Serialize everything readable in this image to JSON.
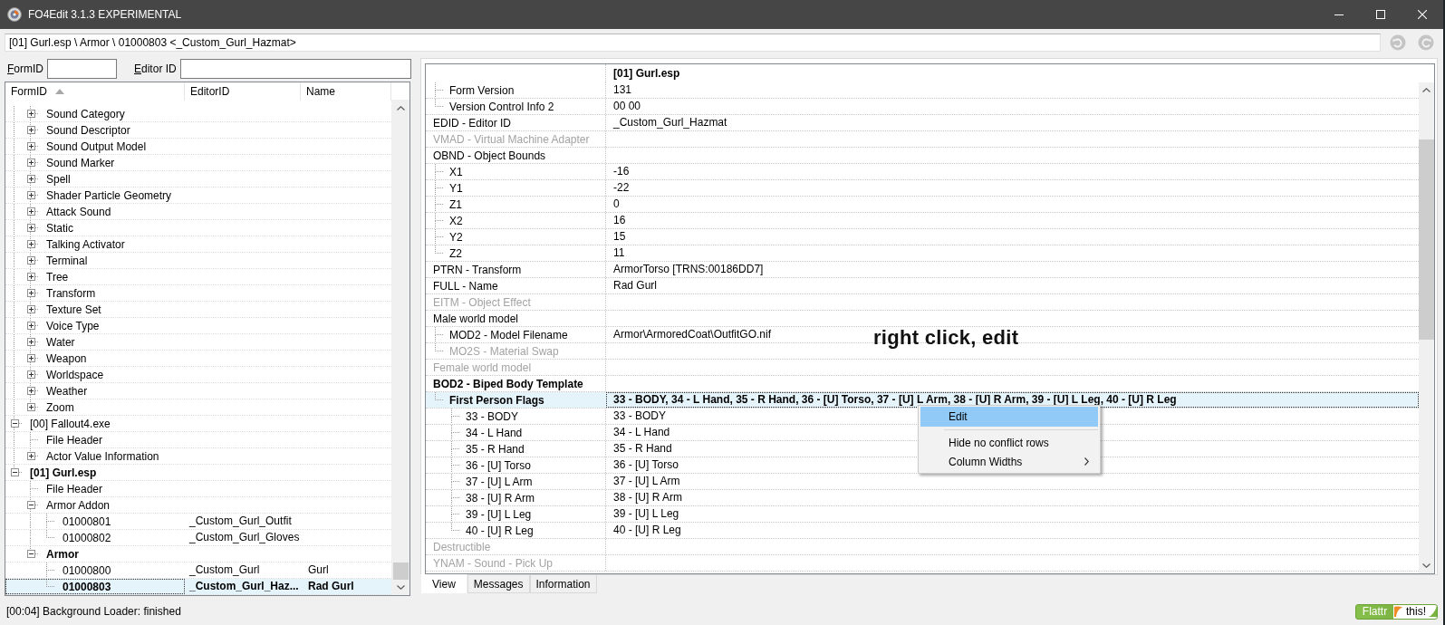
{
  "window": {
    "title": "FO4Edit 3.1.3 EXPERIMENTAL"
  },
  "path_bar": {
    "value": "[01] Gurl.esp \\ Armor \\ 01000803 <_Custom_Gurl_Hazmat>"
  },
  "filters": [
    {
      "label": "FormID"
    },
    {
      "label": "Editor ID"
    }
  ],
  "tree": {
    "columns": [
      {
        "label": "FormID",
        "sorted": true
      },
      {
        "label": "EditorID",
        "sorted": false
      },
      {
        "label": "Name",
        "sorted": false
      }
    ],
    "items": [
      {
        "children": [
          {
            "label": "Sound Category",
            "expanded": false,
            "bold": false,
            "selected": false
          },
          {
            "label": "Sound Descriptor",
            "expanded": false,
            "bold": false,
            "selected": false
          },
          {
            "label": "Sound Output Model",
            "expanded": false,
            "bold": false,
            "selected": false
          },
          {
            "label": "Sound Marker",
            "expanded": false,
            "bold": false,
            "selected": false
          },
          {
            "label": "Spell",
            "expanded": false,
            "bold": false,
            "selected": false
          },
          {
            "label": "Shader Particle Geometry",
            "expanded": false,
            "bold": false,
            "selected": false
          },
          {
            "label": "Attack Sound",
            "expanded": false,
            "bold": false,
            "selected": false
          },
          {
            "label": "Static",
            "expanded": false,
            "bold": false,
            "selected": false
          },
          {
            "label": "Talking Activator",
            "expanded": false,
            "bold": false,
            "selected": false
          },
          {
            "label": "Terminal",
            "expanded": false,
            "bold": false,
            "selected": false
          },
          {
            "label": "Tree",
            "expanded": false,
            "bold": false,
            "selected": false
          },
          {
            "label": "Transform",
            "expanded": false,
            "bold": false,
            "selected": false
          },
          {
            "label": "Texture Set",
            "expanded": false,
            "bold": false,
            "selected": false
          },
          {
            "label": "Voice Type",
            "expanded": false,
            "bold": false,
            "selected": false
          },
          {
            "label": "Water",
            "expanded": false,
            "bold": false,
            "selected": false
          },
          {
            "label": "Weapon",
            "expanded": false,
            "bold": false,
            "selected": false
          },
          {
            "label": "Worldspace",
            "expanded": false,
            "bold": false,
            "selected": false
          },
          {
            "label": "Weather",
            "expanded": false,
            "bold": false,
            "selected": false
          },
          {
            "label": "Zoom",
            "expanded": false,
            "bold": false,
            "selected": false
          }
        ]
      },
      {
        "label": "[00] Fallout4.exe",
        "expanded": true,
        "bold": false,
        "selected": false,
        "children": [
          {
            "label": "File Header",
            "bold": false,
            "selected": false
          },
          {
            "label": "Actor Value Information",
            "expanded": false,
            "bold": false,
            "selected": false
          }
        ]
      },
      {
        "label": "[01] Gurl.esp",
        "expanded": true,
        "bold": true,
        "selected": false,
        "children": [
          {
            "label": "File Header",
            "bold": false,
            "selected": false
          },
          {
            "label": "Armor Addon",
            "expanded": true,
            "bold": false,
            "selected": false,
            "children": [
              {
                "label": "01000801",
                "editor_id": "_Custom_Gurl_Outfit",
                "bold": false,
                "selected": false
              },
              {
                "label": "01000802",
                "editor_id": "_Custom_Gurl_Gloves",
                "bold": false,
                "selected": false
              }
            ]
          },
          {
            "label": "Armor",
            "expanded": true,
            "bold": true,
            "selected": false,
            "children": [
              {
                "label": "01000800",
                "editor_id": "_Custom_Gurl",
                "name": "Gurl",
                "bold": false,
                "selected": false
              },
              {
                "label": "01000803",
                "editor_id": "_Custom_Gurl_Haz...",
                "name": "Rad Gurl",
                "bold": true,
                "selected": true
              }
            ]
          }
        ]
      }
    ]
  },
  "record_view": {
    "file_column": "[01] Gurl.esp",
    "rows": [
      {
        "children": [
          {
            "label": "Form Version",
            "value": "131",
            "greyed": false,
            "bold": false,
            "selected": false
          },
          {
            "label": "Version Control Info 2",
            "value": "00 00",
            "greyed": false,
            "bold": false,
            "selected": false
          }
        ]
      },
      {
        "label": "EDID - Editor ID",
        "value": "_Custom_Gurl_Hazmat",
        "greyed": false,
        "bold": false,
        "selected": false
      },
      {
        "label": "VMAD - Virtual Machine Adapter",
        "greyed": true,
        "bold": false,
        "selected": false
      },
      {
        "label": "OBND - Object Bounds",
        "greyed": false,
        "bold": false,
        "selected": false,
        "children": [
          {
            "label": "X1",
            "value": "-16",
            "greyed": false,
            "bold": false,
            "selected": false
          },
          {
            "label": "Y1",
            "value": "-22",
            "greyed": false,
            "bold": false,
            "selected": false
          },
          {
            "label": "Z1",
            "value": "0",
            "greyed": false,
            "bold": false,
            "selected": false
          },
          {
            "label": "X2",
            "value": "16",
            "greyed": false,
            "bold": false,
            "selected": false
          },
          {
            "label": "Y2",
            "value": "15",
            "greyed": false,
            "bold": false,
            "selected": false
          },
          {
            "label": "Z2",
            "value": "11",
            "greyed": false,
            "bold": false,
            "selected": false
          }
        ]
      },
      {
        "label": "PTRN - Transform",
        "value": "ArmorTorso [TRNS:00186DD7]",
        "greyed": false,
        "bold": false,
        "selected": false
      },
      {
        "label": "FULL - Name",
        "value": "Rad Gurl",
        "greyed": false,
        "bold": false,
        "selected": false
      },
      {
        "label": "EITM - Object Effect",
        "greyed": true,
        "bold": false,
        "selected": false
      },
      {
        "label": "Male world model",
        "greyed": false,
        "bold": false,
        "selected": false,
        "children": [
          {
            "label": "MOD2 - Model Filename",
            "value": "Armor\\ArmoredCoat\\OutfitGO.nif",
            "greyed": false,
            "bold": false,
            "selected": false
          },
          {
            "label": "MO2S - Material Swap",
            "greyed": true,
            "bold": false,
            "selected": false
          }
        ]
      },
      {
        "label": "Female world model",
        "greyed": true,
        "bold": false,
        "selected": false
      },
      {
        "label": "BOD2 - Biped Body Template",
        "greyed": false,
        "bold": true,
        "selected": false,
        "children": [
          {
            "label": "First Person Flags",
            "value": "33 - BODY, 34 - L Hand, 35 - R Hand, 36 - [U] Torso, 37 - [U] L Arm, 38 - [U] R Arm, 39 - [U] L Leg, 40 - [U] R Leg",
            "greyed": false,
            "bold": true,
            "selected": true,
            "children": [
              {
                "label": "33 - BODY",
                "value": "33 - BODY",
                "greyed": false,
                "bold": false,
                "selected": false
              },
              {
                "label": "34 - L Hand",
                "value": "34 - L Hand",
                "greyed": false,
                "bold": false,
                "selected": false
              },
              {
                "label": "35 - R Hand",
                "value": "35 - R Hand",
                "greyed": false,
                "bold": false,
                "selected": false
              },
              {
                "label": "36 - [U] Torso",
                "value": "36 - [U] Torso",
                "greyed": false,
                "bold": false,
                "selected": false
              },
              {
                "label": "37 - [U] L Arm",
                "value": "37 - [U] L Arm",
                "greyed": false,
                "bold": false,
                "selected": false
              },
              {
                "label": "38 - [U] R Arm",
                "value": "38 - [U] R Arm",
                "greyed": false,
                "bold": false,
                "selected": false
              },
              {
                "label": "39 - [U] L Leg",
                "value": "39 - [U] L Leg",
                "greyed": false,
                "bold": false,
                "selected": false
              },
              {
                "label": "40 - [U] R Leg",
                "value": "40 - [U] R Leg",
                "greyed": false,
                "bold": false,
                "selected": false
              }
            ]
          }
        ]
      },
      {
        "label": "Destructible",
        "greyed": true,
        "bold": false,
        "selected": false
      },
      {
        "label": "YNAM - Sound - Pick Up",
        "greyed": true,
        "bold": false,
        "selected": false
      }
    ]
  },
  "annotation": {
    "text": "right click, edit"
  },
  "context_menu": {
    "items": [
      {
        "kind": "command",
        "label": "Edit",
        "selected": true
      },
      {
        "kind": "separator"
      },
      {
        "kind": "command",
        "label": "Hide no conflict rows",
        "selected": false
      },
      {
        "kind": "submenu",
        "label": "Column Widths",
        "selected": false
      }
    ]
  },
  "tabs": [
    {
      "label": "View",
      "selected": true
    },
    {
      "label": "Messages",
      "selected": false
    },
    {
      "label": "Information",
      "selected": false
    }
  ],
  "status_bar": {
    "message": "[00:04] Background Loader: finished",
    "flattr_button": {
      "label": "Flattr",
      "suffix": "this!"
    }
  }
}
